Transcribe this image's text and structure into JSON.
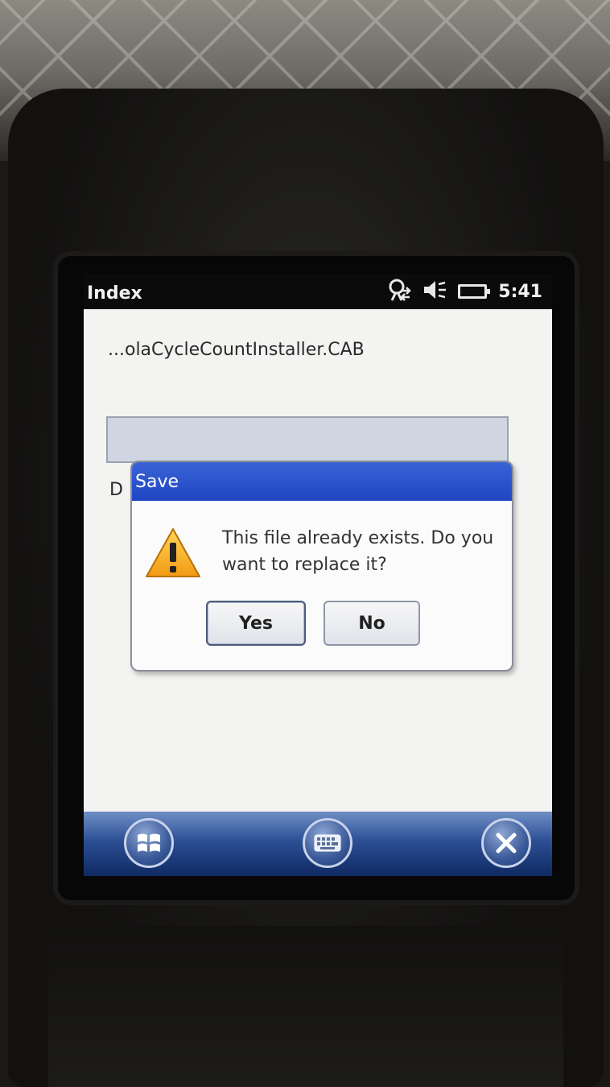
{
  "titlebar": {
    "title": "Index",
    "clock": "5:41",
    "icons": [
      "connectivity-icon",
      "speaker-muted-icon",
      "battery-icon"
    ]
  },
  "content": {
    "filename": "...olaCycleCountInstaller.CAB",
    "partial_label": "D"
  },
  "dialog": {
    "title": "Save",
    "message": "This file already exists. Do you want to replace it?",
    "icon": "warning-icon",
    "yes_label": "Yes",
    "no_label": "No"
  },
  "taskbar": {
    "icons": [
      "windows-start-icon",
      "keyboard-icon",
      "close-icon"
    ]
  },
  "colors": {
    "dialog_title_bg": "#1f45c2",
    "taskbar_bg": "#2d4f95",
    "screen_bg": "#f3f3f1"
  }
}
